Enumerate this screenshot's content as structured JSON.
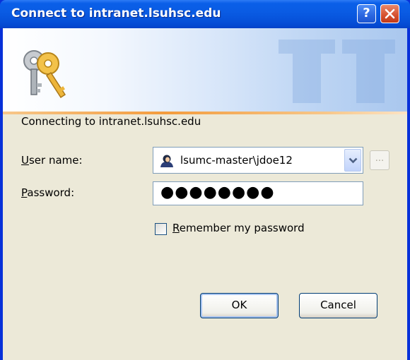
{
  "window": {
    "title": "Connect to intranet.lsuhsc.edu",
    "help_button": "?",
    "close_button_icon": "close-icon"
  },
  "dialog": {
    "connecting_text": "Connecting to intranet.lsuhsc.edu",
    "user_label_first": "U",
    "user_label_rest": "ser name:",
    "password_label_first": "P",
    "password_label_rest": "assword:",
    "user_value": "lsumc-master\\jdoe12",
    "password_value": "●●●●●●●●",
    "browse_label": "...",
    "remember_first": "R",
    "remember_rest": "emember my password",
    "remember_checked": false,
    "ok_label": "OK",
    "cancel_label": "Cancel"
  },
  "colors": {
    "titlebar": "#0A5CE4",
    "dialog_bg": "#ECE9D8",
    "banner_accent": "#F39C3D"
  }
}
